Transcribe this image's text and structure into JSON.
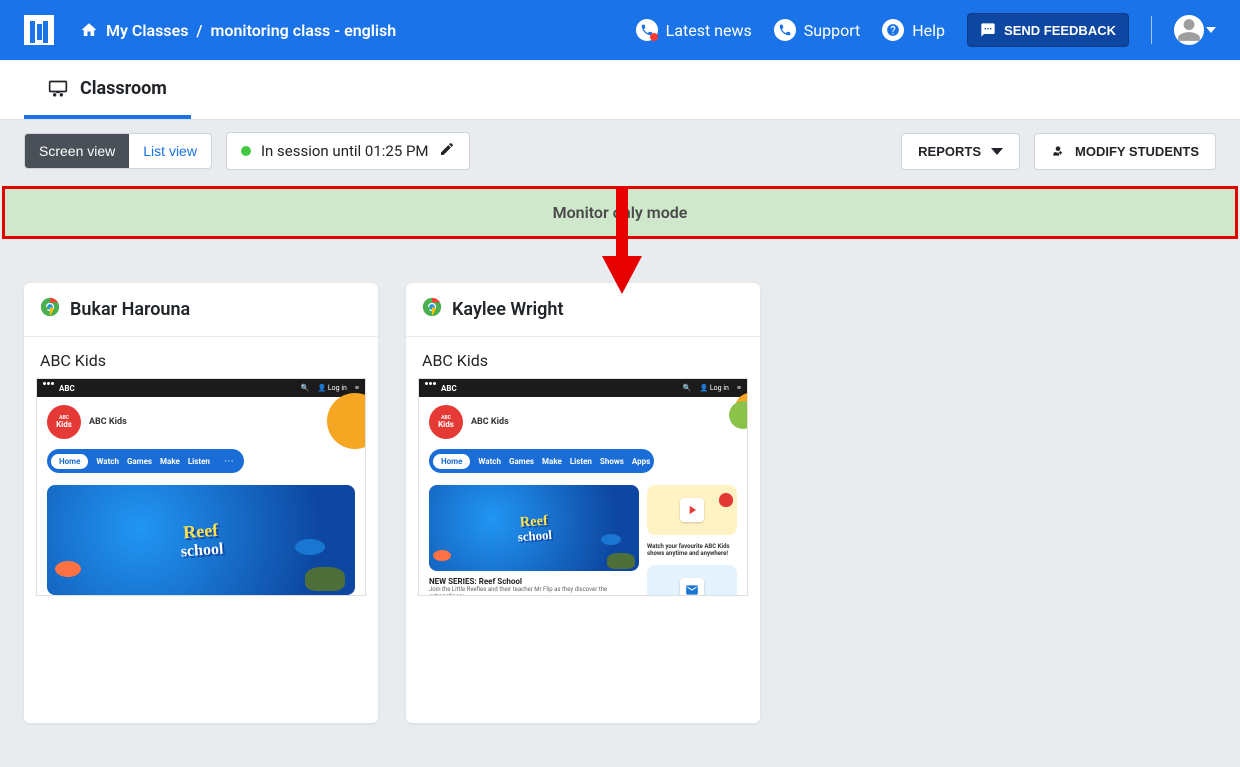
{
  "header": {
    "breadcrumb_root": "My Classes",
    "breadcrumb_sep": "/",
    "breadcrumb_page": "monitoring class - english",
    "latest_news": "Latest news",
    "support": "Support",
    "help": "Help",
    "send_feedback": "SEND FEEDBACK"
  },
  "tab": {
    "label": "Classroom"
  },
  "toolbar": {
    "screen_view": "Screen view",
    "list_view": "List view",
    "session_label": "In session until 01:25 PM",
    "reports": "REPORTS",
    "modify_students": "MODIFY STUDENTS"
  },
  "banner": {
    "text": "Monitor only mode"
  },
  "students": [
    {
      "name": "Bukar Harouna",
      "active_tab": "ABC Kids"
    },
    {
      "name": "Kaylee Wright",
      "active_tab": "ABC Kids"
    }
  ],
  "screenshot": {
    "site_brand": "ABC",
    "login": "Log in",
    "kids_small": "ABC",
    "kids_big": "Kids",
    "kids_label": "ABC Kids",
    "nav_home": "Home",
    "nav_items_short": [
      "Watch",
      "Games",
      "Make",
      "Listen"
    ],
    "nav_items_long": [
      "Watch",
      "Games",
      "Make",
      "Listen",
      "Shows",
      "Apps"
    ],
    "reef1": "Reef",
    "reef2": "school",
    "side_text": "Watch your favourite ABC Kids shows anytime and anywhere!",
    "caption_title": "NEW SERIES: Reef School",
    "caption_sub": "Join the Little Reefies and their teacher Mr Flip as they discover the extraordinary"
  }
}
